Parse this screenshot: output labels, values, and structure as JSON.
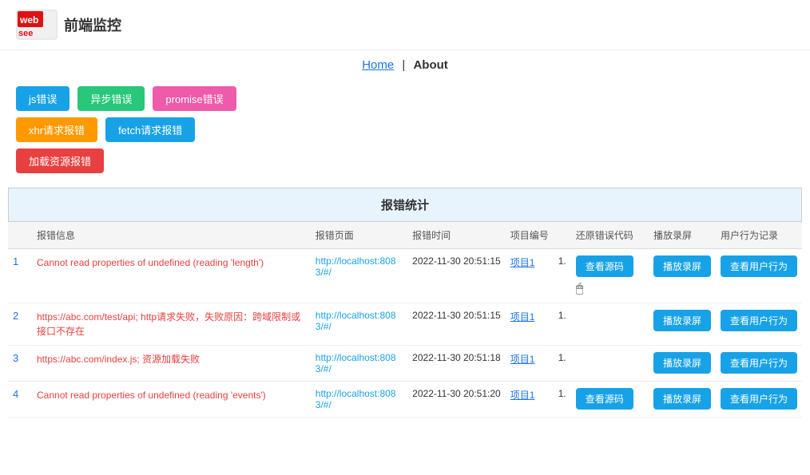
{
  "header": {
    "logo_text": "前端监控",
    "logo_abbr": "websee"
  },
  "nav": {
    "home_label": "Home",
    "separator": "|",
    "about_label": "About"
  },
  "buttons_row1": [
    {
      "label": "js错误",
      "color": "blue"
    },
    {
      "label": "异步错误",
      "color": "green"
    },
    {
      "label": "promise错误",
      "color": "pink"
    }
  ],
  "buttons_row2": [
    {
      "label": "xhr请求报错",
      "color": "orange"
    },
    {
      "label": "fetch请求报错",
      "color": "blue"
    }
  ],
  "buttons_row3": [
    {
      "label": "加载资源报错",
      "color": "red"
    }
  ],
  "table": {
    "title": "报错统计",
    "columns": [
      "报错信息",
      "报错页面",
      "报错时间",
      "项目编号",
      "还原错误代码",
      "播放录屏",
      "用户行为记录"
    ],
    "rows": [
      {
        "num": "1",
        "error": "Cannot read properties of undefined (reading 'length')",
        "page": "http://localhost:8083/#/",
        "time": "2022-11-30 20:51:15",
        "project": "项目1",
        "source_num": "1.",
        "has_source": true,
        "source_label": "查看源码",
        "replay_label": "播放录屏",
        "behavior_label": "查看用户行为"
      },
      {
        "num": "2",
        "error": "https://abc.com/test/api; http请求失败，失败原因：跨域限制或接口不存在",
        "page": "http://localhost:8083/#/",
        "time": "2022-11-30 20:51:15",
        "project": "项目1",
        "source_num": "1.",
        "has_source": false,
        "source_label": "",
        "replay_label": "播放录屏",
        "behavior_label": "查看用户行为"
      },
      {
        "num": "3",
        "error": "https://abc.com/index.js; 资源加载失败",
        "page": "http://localhost:8083/#/",
        "time": "2022-11-30 20:51:18",
        "project": "项目1",
        "source_num": "1.",
        "has_source": false,
        "source_label": "",
        "replay_label": "播放录屏",
        "behavior_label": "查看用户行为"
      },
      {
        "num": "4",
        "error": "Cannot read properties of undefined (reading 'events')",
        "page": "http://localhost:8083/#/",
        "time": "2022-11-30 20:51:20",
        "project": "项目1",
        "source_num": "1.",
        "has_source": true,
        "source_label": "查看源码",
        "replay_label": "播放录屏",
        "behavior_label": "查看用户行为"
      }
    ]
  }
}
